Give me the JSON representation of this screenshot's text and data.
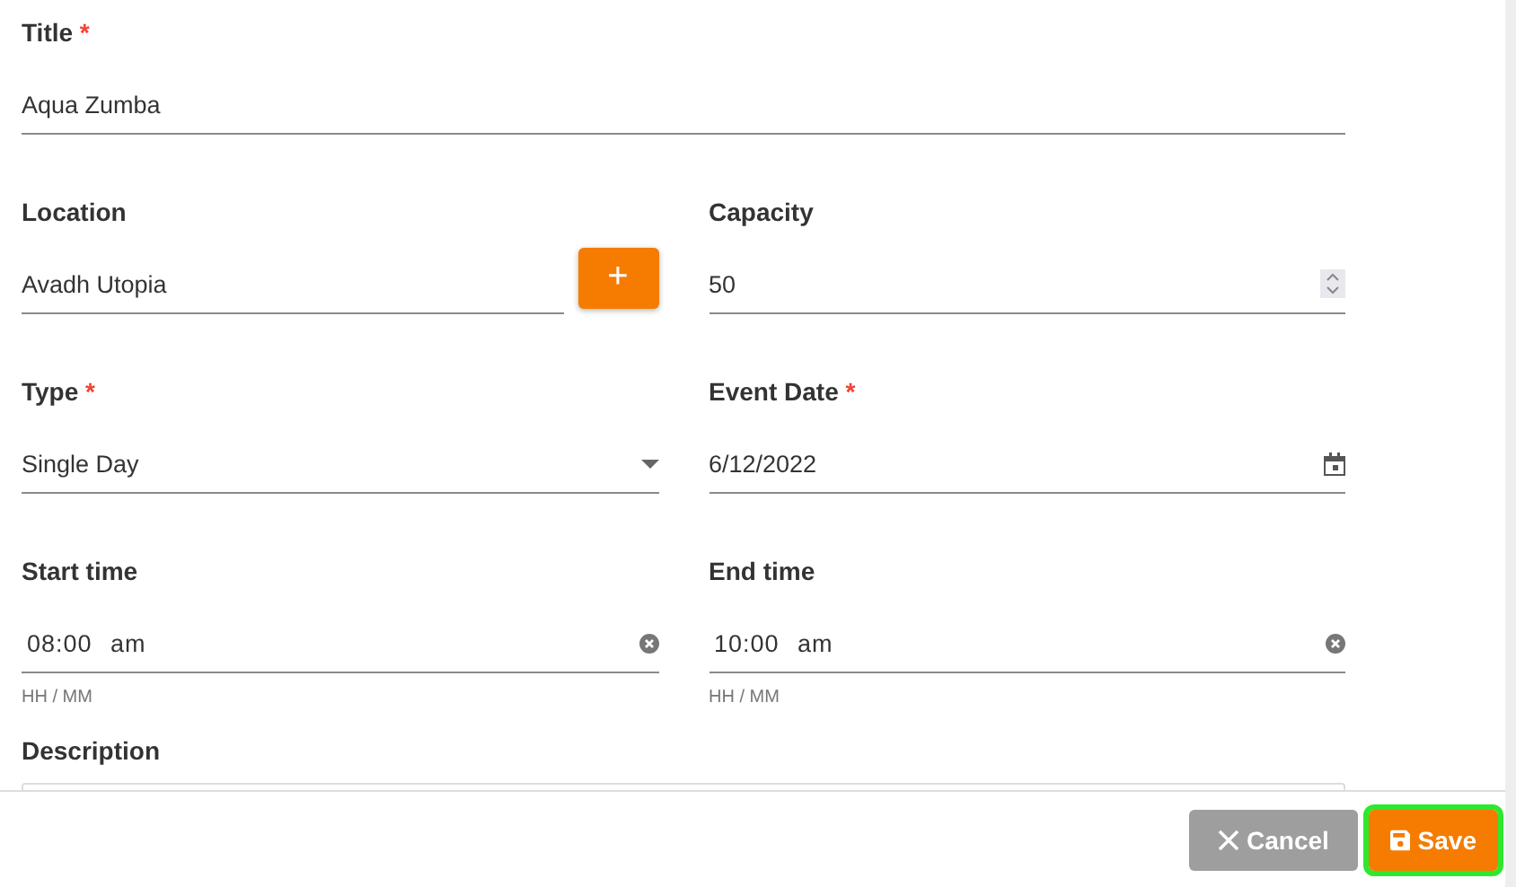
{
  "form": {
    "rows": [
      [
        {
          "kind": "text",
          "label": "Title",
          "required_mark": "*",
          "value": "Aqua Zumba"
        }
      ],
      [
        {
          "kind": "text",
          "label": "Location",
          "value": "Avadh Utopia",
          "action": "+"
        },
        {
          "kind": "number",
          "label": "Capacity",
          "value": "50"
        }
      ],
      [
        {
          "kind": "select",
          "label": "Type",
          "required_mark": "*",
          "value": "Single Day"
        },
        {
          "kind": "date",
          "label": "Event Date",
          "required_mark": "*",
          "value": "6/12/2022"
        }
      ],
      [
        {
          "kind": "time",
          "label": "Start time",
          "value": "08:00 am",
          "hint": "HH / MM"
        },
        {
          "kind": "time",
          "label": "End time",
          "value": "10:00 am",
          "hint": "HH / MM"
        }
      ],
      [
        {
          "kind": "textarea",
          "label": "Description"
        }
      ]
    ]
  },
  "footer": {
    "buttons": [
      {
        "kind": "cancel",
        "label": "Cancel",
        "focused": false
      },
      {
        "kind": "save",
        "label": "Save",
        "focused": true
      }
    ]
  }
}
